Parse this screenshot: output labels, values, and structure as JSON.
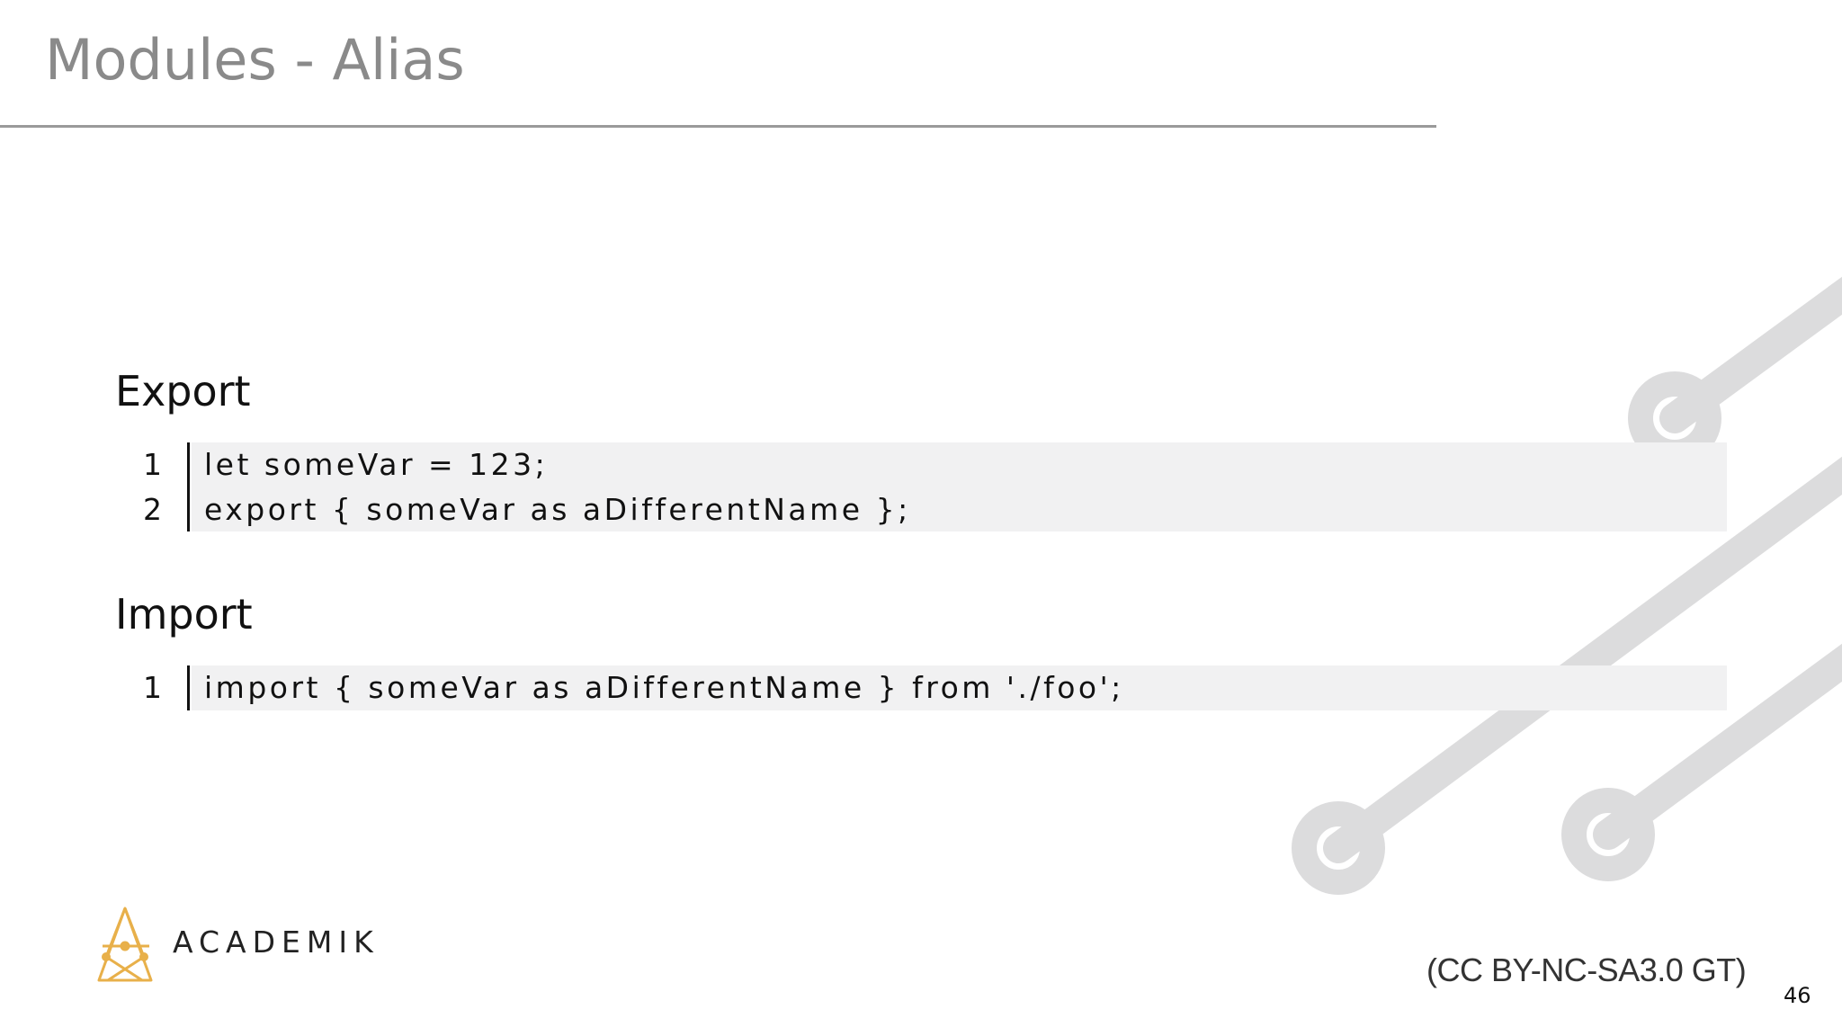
{
  "slide": {
    "title": "Modules - Alias",
    "page_number": "46",
    "license": "(CC BY-NC-SA3.0 GT)"
  },
  "sections": [
    {
      "heading": "Export",
      "lines": [
        {
          "number": "1",
          "code": "let someVar = 123;"
        },
        {
          "number": "2",
          "code": "export { someVar as aDifferentName };"
        }
      ]
    },
    {
      "heading": "Import",
      "lines": [
        {
          "number": "1",
          "code": "import { someVar as aDifferentName } from './foo';"
        }
      ]
    }
  ],
  "logo": {
    "text": "ACADEMIK",
    "color": "#e8b04a"
  },
  "colors": {
    "title": "#8a8a8a",
    "code_background": "#f1f1f2",
    "circuit": "#dcdcdd"
  }
}
